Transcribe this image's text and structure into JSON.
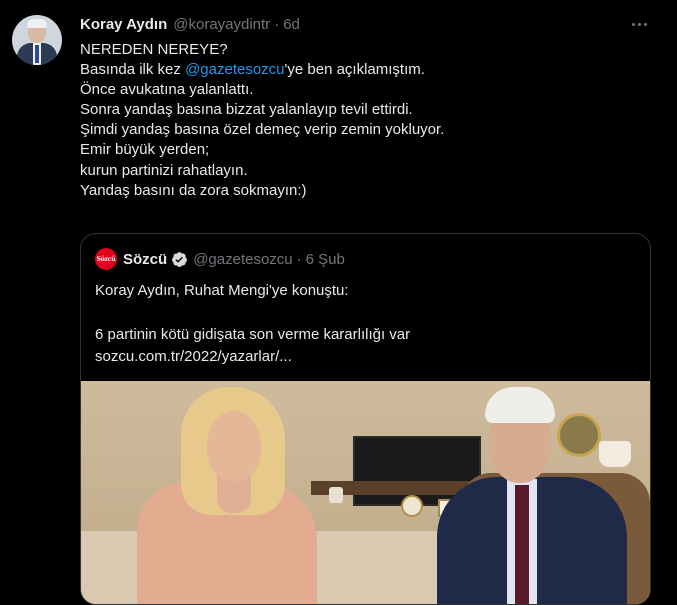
{
  "tweet": {
    "author_name": "Koray Aydın",
    "author_handle": "@korayaydintr",
    "separator": "·",
    "time": "6d",
    "lines": [
      "NEREDEN NEREYE?",
      "",
      "Önce avukatına yalanlattı.",
      "Sonra yandaş basına bizzat yalanlayıp tevil ettirdi.",
      "Şimdi yandaş basına özel demeç verip zemin yokluyor.",
      "Emir büyük yerden;",
      "kurun partinizi rahatlayın.",
      "Yandaş basını da zora sokmayın:)"
    ],
    "line2_prefix": "Basında ilk kez ",
    "line2_mention": "@gazetesozcu",
    "line2_suffix": "'ye ben açıklamıştım."
  },
  "quote": {
    "logo_text": "Sözcü",
    "name": "Sözcü",
    "handle": "@gazetesozcu",
    "separator": "·",
    "time": "6 Şub",
    "line1": "Koray Aydın, Ruhat Mengi'ye konuştu:",
    "line2": "6 partinin kötü gidişata son verme kararlılığı var",
    "line3": "sozcu.com.tr/2022/yazarlar/..."
  },
  "colors": {
    "background": "#000000",
    "text": "#e7e9ea",
    "secondary": "#71767b",
    "link": "#1d9bf0",
    "border": "#2f3336",
    "brand_red": "#e3001b"
  },
  "icons": {
    "more": "more-horizontal-icon",
    "verified": "verified-badge-icon"
  }
}
